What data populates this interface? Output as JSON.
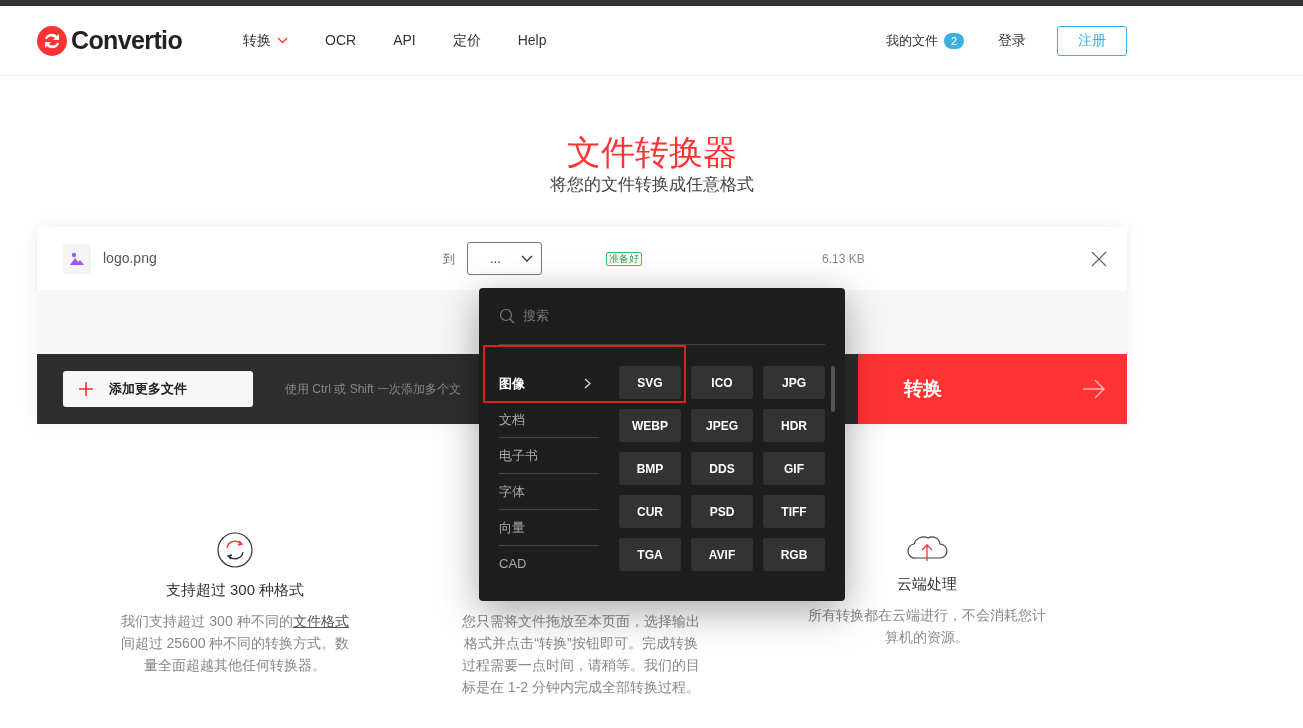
{
  "header": {
    "logo": "Convertio",
    "nav": [
      {
        "label": "转换",
        "has_menu": true
      },
      {
        "label": "OCR",
        "has_menu": false
      },
      {
        "label": "API",
        "has_menu": false
      },
      {
        "label": "定价",
        "has_menu": false
      },
      {
        "label": "Help",
        "has_menu": false
      }
    ],
    "my_files": {
      "label": "我的文件",
      "count": "2"
    },
    "login": "登录",
    "signup": "注册"
  },
  "hero": {
    "title": "文件转换器",
    "subtitle": "将您的文件转换成任意格式"
  },
  "file": {
    "name": "logo.png",
    "to_label": "到",
    "format": "...",
    "status": "准备好",
    "size": "6.13 KB"
  },
  "add_button": "添加更多文件",
  "hint": "使用 Ctrl 或 Shift 一次添加多个文",
  "convert_button": "转换",
  "format_menu": {
    "search_placeholder": "搜索",
    "highlighted": true,
    "categories": [
      {
        "label": "图像",
        "selected": true
      },
      {
        "label": "文档",
        "selected": false
      },
      {
        "label": "电子书",
        "selected": false
      },
      {
        "label": "字体",
        "selected": false
      },
      {
        "label": "向量",
        "selected": false
      },
      {
        "label": "CAD",
        "selected": false
      }
    ],
    "formats": [
      "SVG",
      "ICO",
      "JPG",
      "WEBP",
      "JPEG",
      "HDR",
      "BMP",
      "DDS",
      "GIF",
      "CUR",
      "PSD",
      "TIFF",
      "TGA",
      "AVIF",
      "RGB"
    ]
  },
  "features": [
    {
      "kind": "refresh",
      "title": "支持超过 300 种格式",
      "description": [
        "我们支持超过 300 种不同的",
        "文件格式",
        "间超过 25600 种不同的转换方式。数量全面超越其他任何转换器。"
      ]
    },
    {
      "kind": "hidden",
      "description": [
        "您只需将文件拖放至本页面，选择输出格式并点击“转换”按钮即可。完成转换过程需要一点时间，请稍等。我们的目标是在 1-2 分钟内完成全部转换过程。"
      ]
    },
    {
      "kind": "cloud",
      "title": "云端处理",
      "description": [
        "所有转换都在云端进行，不会消耗您计算机的资源。"
      ]
    }
  ]
}
